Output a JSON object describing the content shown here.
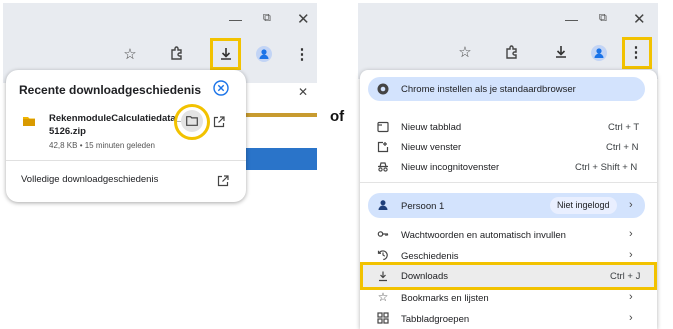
{
  "left": {
    "panel_title": "Recente downloadgeschiedenis",
    "file_name_line1": "RekenmoduleCalculatiedata_",
    "file_name_line2": "5126.zip",
    "file_meta": "42,8 KB • 15 minuten geleden",
    "full_history_label": "Volledige downloadgeschiedenis"
  },
  "separator_word": "of",
  "right": {
    "default_browser_label": "Chrome instellen als je standaardbrowser",
    "items_group1": [
      {
        "label": "Nieuw tabblad",
        "shortcut": "Ctrl + T"
      },
      {
        "label": "Nieuw venster",
        "shortcut": "Ctrl + N"
      },
      {
        "label": "Nieuw incognitovenster",
        "shortcut": "Ctrl + Shift + N"
      }
    ],
    "profile_name": "Persoon 1",
    "profile_status": "Niet ingelogd",
    "items_group2": [
      {
        "label": "Wachtwoorden en automatisch invullen"
      },
      {
        "label": "Geschiedenis"
      },
      {
        "label": "Downloads",
        "shortcut": "Ctrl + J"
      },
      {
        "label": "Bookmarks en lijsten"
      },
      {
        "label": "Tabbladgroepen"
      }
    ]
  },
  "colors": {
    "highlight": "#f2c200",
    "accent_blue": "#1a73e8",
    "toolbar_bg": "#e8ebf0",
    "profile_bg": "#d3e3fd"
  }
}
